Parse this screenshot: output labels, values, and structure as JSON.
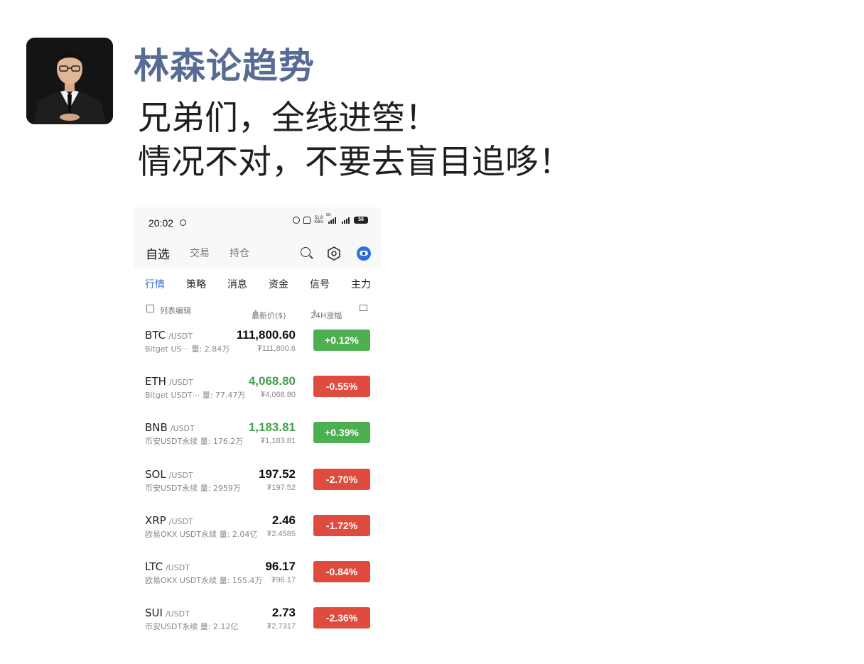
{
  "post": {
    "author": "林森论趋势",
    "lines": [
      "兄弟们，全线进箜！",
      "情况不对，不要去盲目追哆！"
    ]
  },
  "app": {
    "status_bar": {
      "time": "20:02",
      "net_speed": "51.8\nKB/s",
      "signal_label": "5G",
      "battery": "58"
    },
    "top_tabs": [
      {
        "label": "自选",
        "active": true
      },
      {
        "label": "交易",
        "active": false
      },
      {
        "label": "持仓",
        "active": false
      }
    ],
    "sub_tabs": [
      {
        "label": "行情",
        "active": true
      },
      {
        "label": "策略",
        "active": false
      },
      {
        "label": "消息",
        "active": false
      },
      {
        "label": "资金",
        "active": false
      },
      {
        "label": "信号",
        "active": false
      },
      {
        "label": "主力",
        "active": false
      }
    ],
    "list_header": {
      "edit": "列表编辑",
      "price": "最新价($)",
      "change": "24H涨幅"
    },
    "rows": [
      {
        "symbol": "BTC",
        "quote": "/USDT",
        "exchange": "Bitget US···",
        "volume": "量: 2.84万",
        "price": "111,800.60",
        "price_color": "neutral",
        "cny": "₮111,800.6",
        "change": "+0.12%",
        "change_dir": "up"
      },
      {
        "symbol": "ETH",
        "quote": "/USDT",
        "exchange": "Bitget USDT···",
        "volume": "量: 77.47万",
        "price": "4,068.80",
        "price_color": "up",
        "cny": "₮4,068.80",
        "change": "-0.55%",
        "change_dir": "down"
      },
      {
        "symbol": "BNB",
        "quote": "/USDT",
        "exchange": "币安USDT永续",
        "volume": "量: 176.2万",
        "price": "1,183.81",
        "price_color": "up",
        "cny": "₮1,183.81",
        "change": "+0.39%",
        "change_dir": "up"
      },
      {
        "symbol": "SOL",
        "quote": "/USDT",
        "exchange": "币安USDT永续",
        "volume": "量: 2959万",
        "price": "197.52",
        "price_color": "neutral",
        "cny": "₮197.52",
        "change": "-2.70%",
        "change_dir": "down"
      },
      {
        "symbol": "XRP",
        "quote": "/USDT",
        "exchange": "欧易OKX USDT永续",
        "volume": "量: 2.04亿",
        "price": "2.46",
        "price_color": "neutral",
        "cny": "₮2.4585",
        "change": "-1.72%",
        "change_dir": "down"
      },
      {
        "symbol": "LTC",
        "quote": "/USDT",
        "exchange": "欧易OKX USDT永续",
        "volume": "量: 155.4万",
        "price": "96.17",
        "price_color": "neutral",
        "cny": "₮96.17",
        "change": "-0.84%",
        "change_dir": "down"
      },
      {
        "symbol": "SUI",
        "quote": "/USDT",
        "exchange": "币安USDT永续",
        "volume": "量: 2.12亿",
        "price": "2.73",
        "price_color": "neutral",
        "cny": "₮2.7317",
        "change": "-2.36%",
        "change_dir": "down"
      }
    ],
    "colors": {
      "up": "#4caf50",
      "down": "#e04b3f",
      "accent": "#2f6fd8"
    }
  }
}
